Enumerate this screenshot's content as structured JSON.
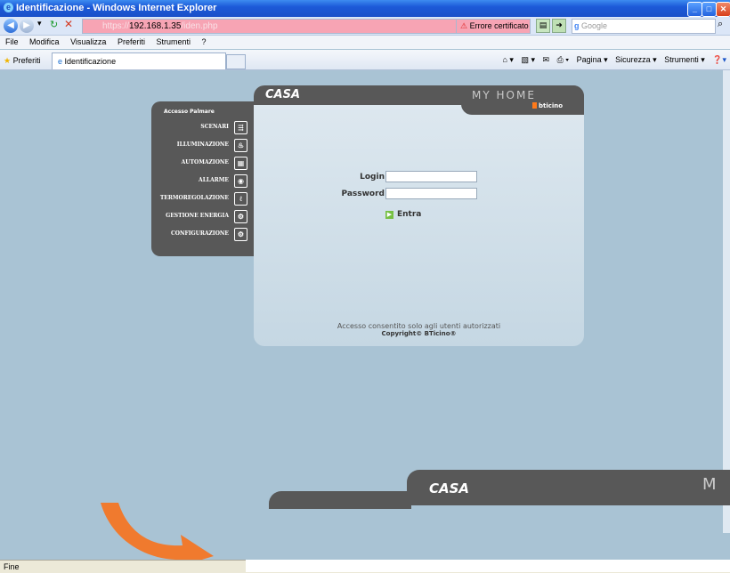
{
  "window": {
    "title": "Identificazione - Windows Internet Explorer"
  },
  "address": {
    "protocol": "https://",
    "host": "192.168.1.35",
    "path": "/iden.php",
    "cert_error": "Errore certificato",
    "search_placeholder": "Google"
  },
  "menu": {
    "items": [
      "File",
      "Modifica",
      "Visualizza",
      "Preferiti",
      "Strumenti",
      "?"
    ]
  },
  "favorites": {
    "label": "Preferiti",
    "tab_title": "Identificazione",
    "commands": [
      "Pagina",
      "Sicurezza",
      "Strumenti"
    ]
  },
  "side_menu": {
    "heading": "Accesso Palmare",
    "items": [
      {
        "label": "SCENARI",
        "icon": "scenari-icon"
      },
      {
        "label": "ILLUMINAZIONE",
        "icon": "lightbulb-icon"
      },
      {
        "label": "AUTOMAZIONE",
        "icon": "shutter-icon"
      },
      {
        "label": "ALLARME",
        "icon": "alarm-icon"
      },
      {
        "label": "TERMOREGOLAZIONE",
        "icon": "thermometer-icon"
      },
      {
        "label": "GESTIONE ENERGIA",
        "icon": "energy-icon"
      },
      {
        "label": "CONFIGURAZIONE",
        "icon": "settings-icon"
      }
    ]
  },
  "login": {
    "header": "CASA",
    "brand": "MY HOME",
    "brand_sub": "bticino",
    "login_label": "Login",
    "password_label": "Password",
    "submit_label": "Entra",
    "notice": "Accesso consentito solo agli utenti autorizzati",
    "copyright": "Copyright© BTicino®"
  },
  "bottom": {
    "casa": "CASA",
    "brand_partial": "M"
  },
  "status": {
    "text": "Fine"
  }
}
